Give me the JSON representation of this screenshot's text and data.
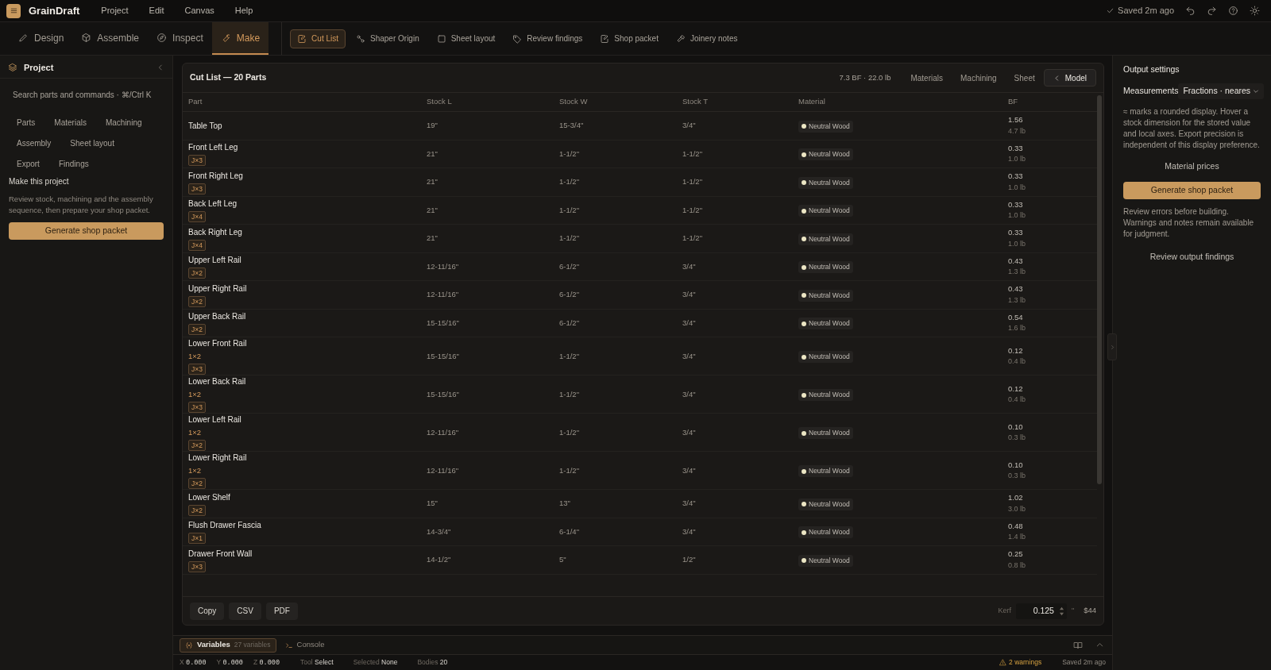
{
  "app": {
    "name": "GrainDraft",
    "menu": [
      "Project",
      "Edit",
      "Canvas",
      "Help"
    ],
    "save_status": "Saved 2m ago"
  },
  "mode_tabs": [
    {
      "label": "Design",
      "selected": false
    },
    {
      "label": "Assemble",
      "selected": false
    },
    {
      "label": "Inspect",
      "selected": false
    },
    {
      "label": "Make",
      "selected": true
    }
  ],
  "sub_tabs": [
    {
      "label": "Cut List",
      "selected": true
    },
    {
      "label": "Shaper Origin",
      "selected": false
    },
    {
      "label": "Sheet layout",
      "selected": false
    },
    {
      "label": "Review findings",
      "selected": false
    },
    {
      "label": "Shop packet",
      "selected": false
    },
    {
      "label": "Joinery notes",
      "selected": false
    }
  ],
  "sidebar": {
    "title": "Project",
    "search": {
      "placeholder": "Search parts and commands · ⌘/Ctrl K"
    },
    "links": [
      "Parts",
      "Materials",
      "Machining",
      "Assembly",
      "Sheet layout",
      "Export",
      "Findings"
    ],
    "section_title": "Make this project",
    "description": "Review stock, machining and the assembly sequence, then prepare your shop packet.",
    "button": "Generate shop packet"
  },
  "cut_list": {
    "title": "Cut List — 20 Parts",
    "summary": "7.3 BF · 22.0 lb",
    "views": [
      {
        "label": "Materials",
        "selected": false
      },
      {
        "label": "Machining",
        "selected": false
      },
      {
        "label": "Sheet",
        "selected": false
      },
      {
        "label": "Model",
        "selected": true
      }
    ],
    "columns": [
      "Part",
      "Stock L",
      "Stock W",
      "Stock T",
      "Material",
      "BF"
    ],
    "rows": [
      {
        "part": "Table Top",
        "stock_l": "19\"",
        "stock_w": "15-3/4\"",
        "stock_t": "3/4\"",
        "material": "Neutral Wood",
        "bf": "1.56",
        "weight": "4.7 lb"
      },
      {
        "part": "Front Left Leg",
        "joints": "J×3",
        "stock_l": "21\"",
        "stock_w": "1-1/2\"",
        "stock_t": "1-1/2\"",
        "material": "Neutral Wood",
        "bf": "0.33",
        "weight": "1.0 lb"
      },
      {
        "part": "Front Right Leg",
        "joints": "J×3",
        "stock_l": "21\"",
        "stock_w": "1-1/2\"",
        "stock_t": "1-1/2\"",
        "material": "Neutral Wood",
        "bf": "0.33",
        "weight": "1.0 lb"
      },
      {
        "part": "Back Left Leg",
        "joints": "J×4",
        "stock_l": "21\"",
        "stock_w": "1-1/2\"",
        "stock_t": "1-1/2\"",
        "material": "Neutral Wood",
        "bf": "0.33",
        "weight": "1.0 lb"
      },
      {
        "part": "Back Right Leg",
        "joints": "J×4",
        "stock_l": "21\"",
        "stock_w": "1-1/2\"",
        "stock_t": "1-1/2\"",
        "material": "Neutral Wood",
        "bf": "0.33",
        "weight": "1.0 lb"
      },
      {
        "part": "Upper Left Rail",
        "joints": "J×2",
        "stock_l": "12-11/16\"",
        "stock_w": "6-1/2\"",
        "stock_t": "3/4\"",
        "material": "Neutral Wood",
        "bf": "0.43",
        "weight": "1.3 lb"
      },
      {
        "part": "Upper Right Rail",
        "joints": "J×2",
        "stock_l": "12-11/16\"",
        "stock_w": "6-1/2\"",
        "stock_t": "3/4\"",
        "material": "Neutral Wood",
        "bf": "0.43",
        "weight": "1.3 lb"
      },
      {
        "part": "Upper Back Rail",
        "joints": "J×2",
        "stock_l": "15-15/16\"",
        "stock_w": "6-1/2\"",
        "stock_t": "3/4\"",
        "material": "Neutral Wood",
        "bf": "0.54",
        "weight": "1.6 lb"
      },
      {
        "part": "Lower Front Rail",
        "nominal": "1×2",
        "joints": "J×3",
        "stock_l": "15-15/16\"",
        "stock_w": "1-1/2\"",
        "stock_t": "3/4\"",
        "material": "Neutral Wood",
        "bf": "0.12",
        "weight": "0.4 lb"
      },
      {
        "part": "Lower Back Rail",
        "nominal": "1×2",
        "joints": "J×3",
        "stock_l": "15-15/16\"",
        "stock_w": "1-1/2\"",
        "stock_t": "3/4\"",
        "material": "Neutral Wood",
        "bf": "0.12",
        "weight": "0.4 lb"
      },
      {
        "part": "Lower Left Rail",
        "nominal": "1×2",
        "joints": "J×2",
        "stock_l": "12-11/16\"",
        "stock_w": "1-1/2\"",
        "stock_t": "3/4\"",
        "material": "Neutral Wood",
        "bf": "0.10",
        "weight": "0.3 lb"
      },
      {
        "part": "Lower Right Rail",
        "nominal": "1×2",
        "joints": "J×2",
        "stock_l": "12-11/16\"",
        "stock_w": "1-1/2\"",
        "stock_t": "3/4\"",
        "material": "Neutral Wood",
        "bf": "0.10",
        "weight": "0.3 lb"
      },
      {
        "part": "Lower Shelf",
        "joints": "J×2",
        "stock_l": "15\"",
        "stock_w": "13\"",
        "stock_t": "3/4\"",
        "material": "Neutral Wood",
        "bf": "1.02",
        "weight": "3.0 lb"
      },
      {
        "part": "Flush Drawer Fascia",
        "joints": "J×1",
        "stock_l": "14-3/4\"",
        "stock_w": "6-1/4\"",
        "stock_t": "3/4\"",
        "material": "Neutral Wood",
        "bf": "0.48",
        "weight": "1.4 lb"
      },
      {
        "part": "Drawer Front Wall",
        "joints": "J×3",
        "stock_l": "14-1/2\"",
        "stock_w": "5\"",
        "stock_t": "1/2\"",
        "material": "Neutral Wood",
        "bf": "0.25",
        "weight": "0.8 lb"
      }
    ],
    "export_buttons": [
      "Copy",
      "CSV",
      "PDF"
    ],
    "kerf": {
      "label": "Kerf",
      "value": "0.125",
      "unit": "\""
    },
    "cost": "$44"
  },
  "output_settings": {
    "title": "Output settings",
    "measurements_label": "Measurements",
    "measurements_value": "Fractions · neares",
    "note": "≈ marks a rounded display. Hover a stock dimension for the stored value and local axes. Export precision is independent of this display preference.",
    "prices_link": "Material prices",
    "button": "Generate shop packet",
    "warning_note": "Review errors before building. Warnings and notes remain available for judgment.",
    "findings_link": "Review output findings"
  },
  "bottom_tabs": [
    {
      "label": "Variables",
      "count": "27 variables",
      "selected": true
    },
    {
      "label": "Console",
      "selected": false
    }
  ],
  "status_bar": {
    "coords": [
      {
        "axis": "X",
        "value": "0.000"
      },
      {
        "axis": "Y",
        "value": "0.000"
      },
      {
        "axis": "Z",
        "value": "0.000"
      }
    ],
    "fields": [
      {
        "label": "Tool",
        "value": "Select"
      },
      {
        "label": "Selected",
        "value": "None"
      },
      {
        "label": "Bodies",
        "value": "20"
      }
    ],
    "warnings": "2 warnings",
    "saved": "Saved 2m ago"
  }
}
